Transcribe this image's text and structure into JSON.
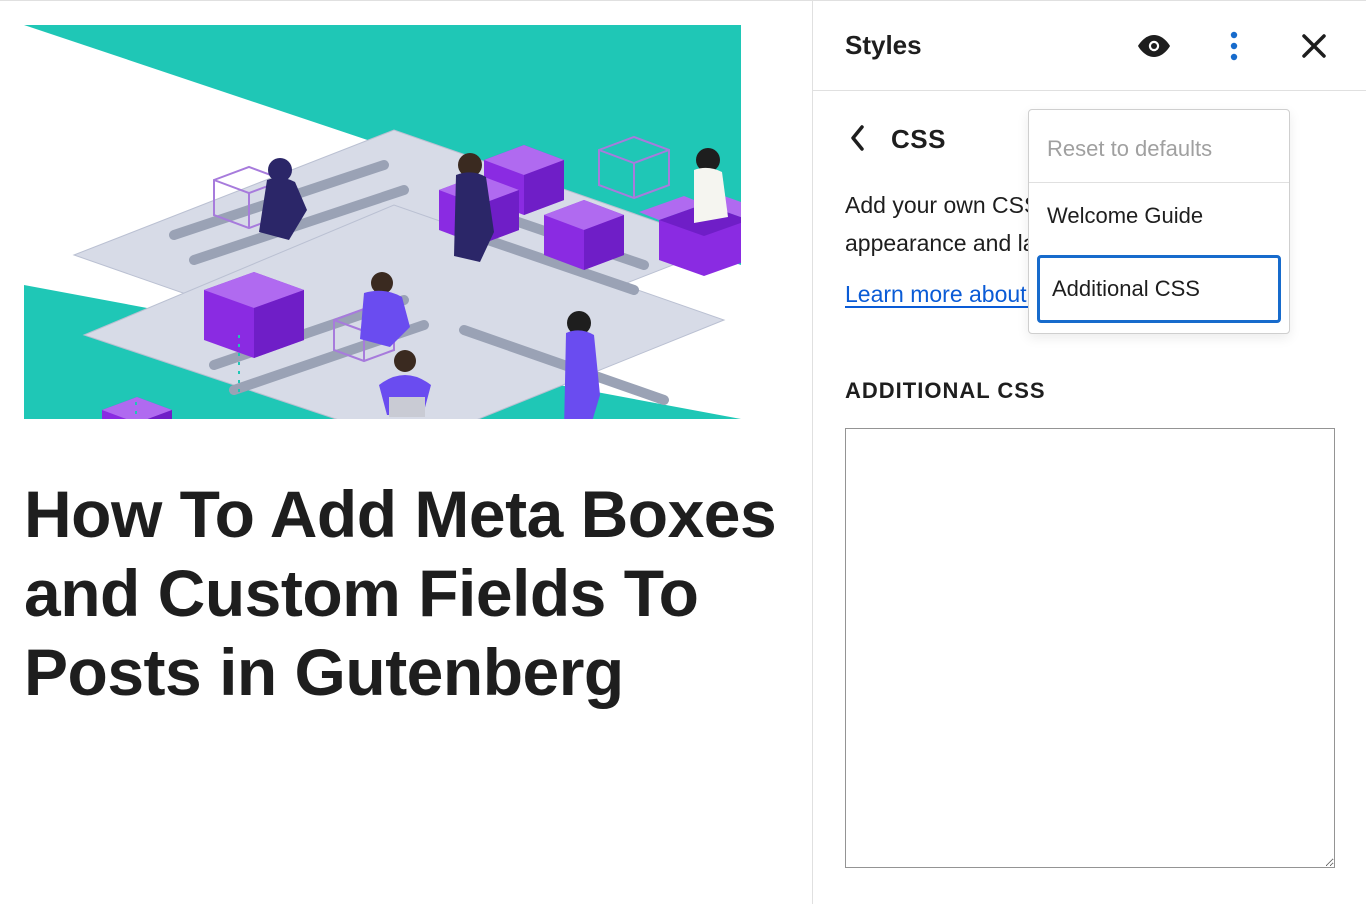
{
  "canvas": {
    "post_title": "How To Add Meta Boxes and Custom Fields To Posts in Gutenberg"
  },
  "sidebar": {
    "title": "Styles",
    "crumb": "CSS",
    "description_visible": "Add your own CSS to customize the appearance and layout of your site.",
    "link_text_visible": "Learn more about CSS",
    "section_label": "ADDITIONAL CSS",
    "css_value": ""
  },
  "dropdown": {
    "reset": "Reset to defaults",
    "welcome": "Welcome Guide",
    "additional": "Additional CSS"
  },
  "icons": {
    "style_book": "style-book-icon",
    "more": "more-vertical-icon",
    "close": "close-icon",
    "back": "chevron-left-icon"
  },
  "colors": {
    "accent": "#176bcc",
    "link": "#0a5bd6",
    "teal": "#1fc7b6",
    "purple": "#8a2be2"
  }
}
